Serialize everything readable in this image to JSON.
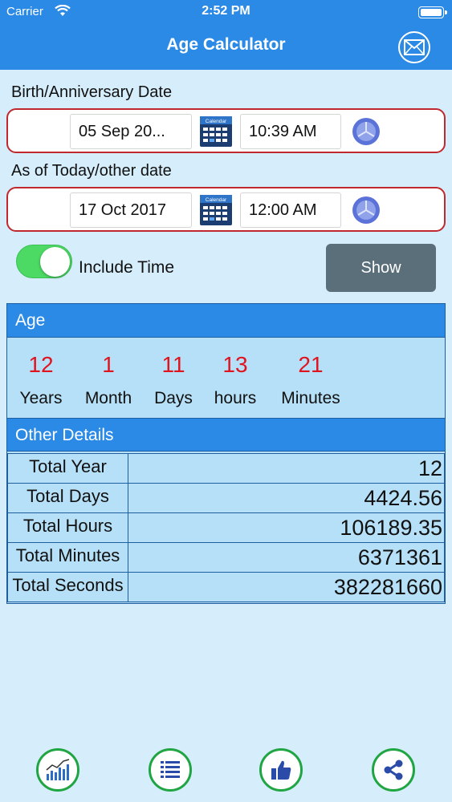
{
  "status": {
    "carrier": "Carrier",
    "time": "2:52 PM"
  },
  "nav": {
    "title": "Age Calculator",
    "mail_icon": "mail-icon"
  },
  "birth": {
    "label": "Birth/Anniversary Date",
    "date": "05 Sep 20...",
    "time": "10:39 AM",
    "calendar_text": "Calendar"
  },
  "asof": {
    "label": "As of Today/other date",
    "date": "17 Oct 2017",
    "time": "12:00 AM",
    "calendar_text": "Calendar"
  },
  "options": {
    "include_time_label": "Include Time",
    "include_time_on": true,
    "show_label": "Show"
  },
  "age": {
    "header": "Age",
    "cells": [
      {
        "value": "12",
        "unit": "Years"
      },
      {
        "value": "1",
        "unit": "Month"
      },
      {
        "value": "11",
        "unit": "Days"
      },
      {
        "value": "13",
        "unit": "hours"
      },
      {
        "value": "21",
        "unit": "Minutes"
      }
    ]
  },
  "details": {
    "header": "Other Details",
    "rows": [
      {
        "key": "Total Year",
        "value": "12"
      },
      {
        "key": "Total Days",
        "value": "4424.56"
      },
      {
        "key": "Total Hours",
        "value": "106189.35"
      },
      {
        "key": "Total Minutes",
        "value": "6371361"
      },
      {
        "key": "Total Seconds",
        "value": "382281660"
      }
    ]
  },
  "bottom_bar": [
    "chart-icon",
    "list-icon",
    "thumbs-up-icon",
    "share-icon"
  ],
  "colors": {
    "nav": "#2b8ae5",
    "accent_red": "#e0141e",
    "toggle_on": "#4cd964",
    "tab_ring": "#1fa542"
  }
}
